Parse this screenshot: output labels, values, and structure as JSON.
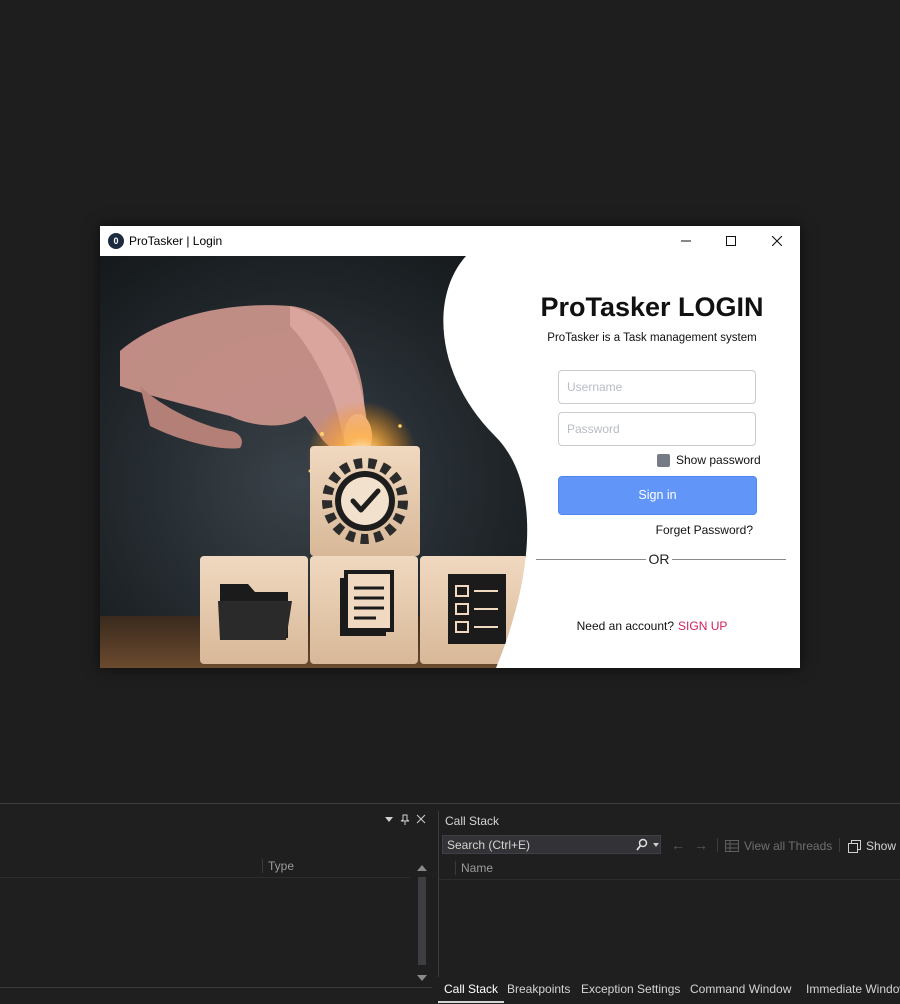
{
  "window": {
    "title": "ProTasker | Login",
    "app_icon_text": "0"
  },
  "login": {
    "heading": "ProTasker LOGIN",
    "subtitle": "ProTasker is a Task management system",
    "username_placeholder": "Username",
    "password_placeholder": "Password",
    "show_password_label": "Show password",
    "show_password_checked": false,
    "signin_label": "Sign in",
    "forget_label": "Forget Password?",
    "or_label": "OR",
    "need_account_label": "Need an account?",
    "signup_label": "SIGN UP"
  },
  "colors": {
    "accent_button": "#6196f8",
    "signup_link": "#d2205a",
    "ide_background": "#1e1e1e"
  },
  "ide": {
    "left_panel": {
      "type_column": "Type"
    },
    "right_panel": {
      "title": "Call Stack",
      "search_placeholder": "Search (Ctrl+E)",
      "back_arrow": "←",
      "forward_arrow": "→",
      "view_threads_label": "View all Threads",
      "show_label": "Show I",
      "name_column": "Name"
    },
    "tabs": [
      "Call Stack",
      "Breakpoints",
      "Exception Settings",
      "Command Window",
      "Immediate Window"
    ]
  }
}
